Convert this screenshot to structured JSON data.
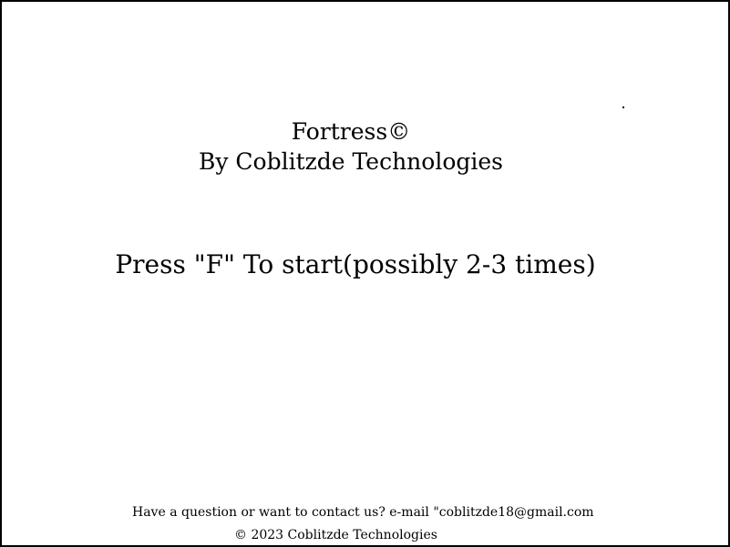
{
  "title": {
    "game_name": "Fortress©",
    "byline": "By Coblitzde Technologies"
  },
  "prompt": {
    "start_text": "Press \"F\" To start(possibly 2-3 times)"
  },
  "footer": {
    "contact": "Have a question or want to contact us? e-mail \"coblitzde18@gmail.com",
    "copyright": "© 2023 Coblitzde Technologies"
  }
}
